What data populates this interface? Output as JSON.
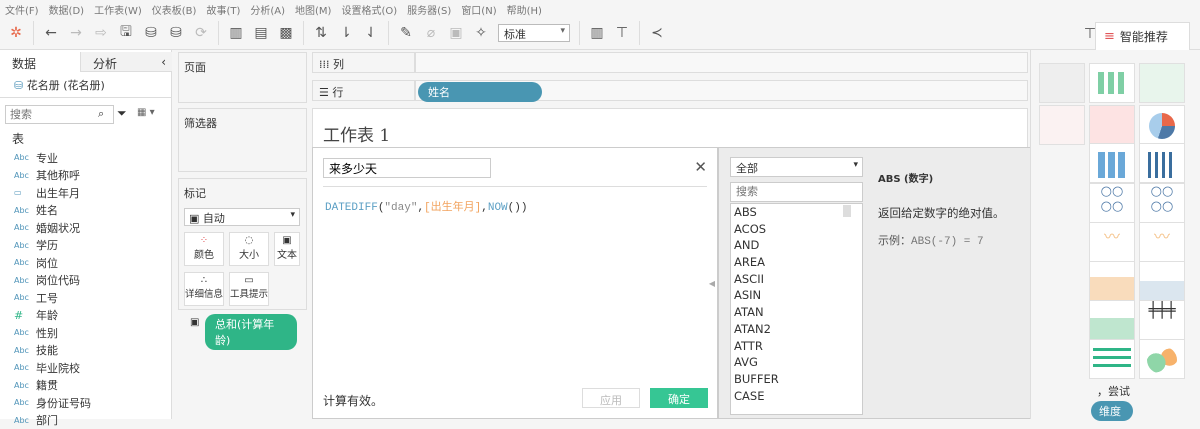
{
  "menu": [
    "文件(F)",
    "数据(D)",
    "工作表(W)",
    "仪表板(B)",
    "故事(T)",
    "分析(A)",
    "地图(M)",
    "设置格式(O)",
    "服务器(S)",
    "窗口(N)",
    "帮助(H)"
  ],
  "toolbar": {
    "fit": "标准",
    "smart_label": "智能推荐"
  },
  "left": {
    "tab_data": "数据",
    "tab_analysis": "分析",
    "datasource": "花名册 (花名册)",
    "search_placeholder": "搜索",
    "table_header": "表",
    "fields": [
      {
        "type": "Abc",
        "name": "专业"
      },
      {
        "type": "Abc",
        "name": "其他称呼"
      },
      {
        "type": "date",
        "name": "出生年月"
      },
      {
        "type": "Abc",
        "name": "姓名"
      },
      {
        "type": "Abc",
        "name": "婚姻状况"
      },
      {
        "type": "Abc",
        "name": "学历"
      },
      {
        "type": "Abc",
        "name": "岗位"
      },
      {
        "type": "Abc",
        "name": "岗位代码"
      },
      {
        "type": "Abc",
        "name": "工号"
      },
      {
        "type": "#",
        "name": "年龄"
      },
      {
        "type": "Abc",
        "name": "性别"
      },
      {
        "type": "Abc",
        "name": "技能"
      },
      {
        "type": "Abc",
        "name": "毕业院校"
      },
      {
        "type": "Abc",
        "name": "籍贯"
      },
      {
        "type": "Abc",
        "name": "身份证号码"
      },
      {
        "type": "Abc",
        "name": "部门"
      }
    ]
  },
  "cards": {
    "pages": "页面",
    "filters": "筛选器",
    "marks": "标记",
    "mark_type": "自动",
    "color": "颜色",
    "size": "大小",
    "text": "文本",
    "detail": "详细信息",
    "tooltip": "工具提示",
    "mark_pill": "总和(计算年龄)"
  },
  "shelves": {
    "columns": "列",
    "rows": "行",
    "row_pill": "姓名"
  },
  "sheet_title": "工作表 1",
  "calc": {
    "name": "来多少天",
    "formula_fn": "DATEDIFF",
    "formula_str": "\"day\"",
    "formula_field": "[出生年月]",
    "formula_now": "NOW",
    "status": "计算有效。",
    "apply": "应用",
    "ok": "确定"
  },
  "functions": {
    "category": "全部",
    "search_placeholder": "搜索",
    "list": [
      "ABS",
      "ACOS",
      "AND",
      "AREA",
      "ASCII",
      "ASIN",
      "ATAN",
      "ATAN2",
      "ATTR",
      "AVG",
      "BUFFER",
      "CASE"
    ],
    "sig": "ABS (数字)",
    "desc": "返回给定数字的绝对值。",
    "example_label": "示例：",
    "example": "ABS(-7) = 7"
  },
  "showme": {
    "hint": "，尝试",
    "pill": "维度"
  },
  "colors": {
    "green": "#2fbf8a",
    "blue": "#4996b2",
    "orange": "#f28e2b"
  }
}
